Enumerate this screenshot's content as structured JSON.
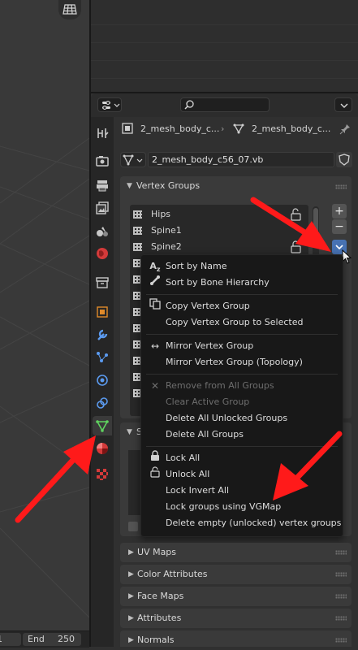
{
  "timeline": {
    "field1": "1",
    "end_label": "End",
    "end_value": "250"
  },
  "breadcrumb": {
    "object_name": "2_mesh_body_c...",
    "mesh_name": "2_mesh_body_c..."
  },
  "mesh_data": {
    "name": "2_mesh_body_c56_07.vb"
  },
  "vertex_groups": {
    "title": "Vertex Groups",
    "items": [
      "Hips",
      "Spine1",
      "Spine2"
    ],
    "add": "+",
    "remove": "−"
  },
  "shape_keys_initial": "S",
  "menu": {
    "sort_by_name": "Sort by Name",
    "sort_by_bone": "Sort by Bone Hierarchy",
    "copy_vg": "Copy Vertex Group",
    "copy_vg_selected": "Copy Vertex Group to Selected",
    "mirror_vg": "Mirror Vertex Group",
    "mirror_vg_topology": "Mirror Vertex Group (Topology)",
    "remove_all": "Remove from All Groups",
    "clear_active": "Clear Active Group",
    "delete_unlocked": "Delete All Unlocked Groups",
    "delete_all": "Delete All Groups",
    "lock_all": "Lock All",
    "unlock_all": "Unlock All",
    "lock_invert": "Lock Invert All",
    "lock_vgmap": "Lock groups using VGMap",
    "delete_empty": "Delete empty (unlocked) vertex groups"
  },
  "panels": [
    "UV Maps",
    "Color Attributes",
    "Face Maps",
    "Attributes",
    "Normals"
  ],
  "colors": {
    "accent": "#4772b3",
    "arrow": "#ff1a1a",
    "mesh_tab": "#5fd35f"
  }
}
